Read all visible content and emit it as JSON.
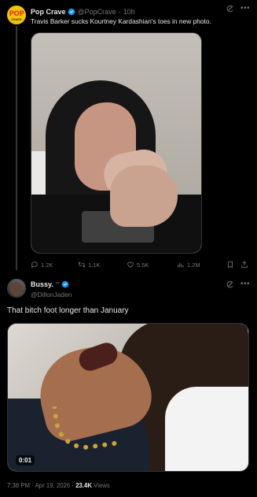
{
  "colors": {
    "background": "#000000",
    "text_primary": "#e7e9ea",
    "text_secondary": "#71767b",
    "verified": "#1d9bf0",
    "border": "#2f3336"
  },
  "tweet1": {
    "display_name": "Pop Crave",
    "handle": "@PopCrave",
    "separator": "·",
    "time": "10h",
    "text": "Travis Barker sucks Kourtney Kardashian's toes in new photo.",
    "avatar_text": "POP",
    "avatar_subtext": "CRAVE",
    "actions": {
      "replies": "1.2K",
      "reposts": "1.1K",
      "likes": "5.5K",
      "views": "1.2M"
    },
    "icons": [
      "grok-icon",
      "more-icon",
      "reply-icon",
      "repost-icon",
      "like-icon",
      "views-icon",
      "bookmark-icon",
      "share-icon"
    ]
  },
  "tweet2": {
    "display_name": "Bussy.",
    "name_suffix": "™",
    "handle": "@DillonJaden",
    "text": "That bitch foot longer than January",
    "video_duration": "0:01",
    "meta": {
      "time": "7:38 PM",
      "dot": "·",
      "date": "Apr 19, 2026",
      "views_count": "23.4K",
      "views_label": "Views"
    }
  }
}
